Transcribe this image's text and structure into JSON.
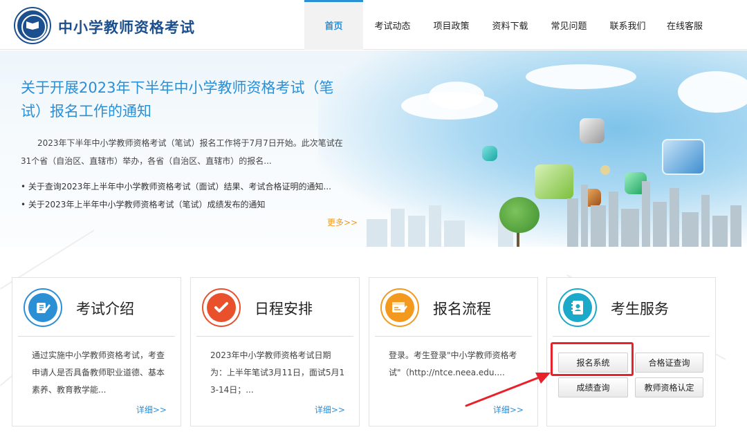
{
  "header": {
    "site_title": "中小学教师资格考试",
    "nav": [
      {
        "label": "首页",
        "active": true
      },
      {
        "label": "考试动态"
      },
      {
        "label": "项目政策"
      },
      {
        "label": "资料下载"
      },
      {
        "label": "常见问题"
      },
      {
        "label": "联系我们"
      },
      {
        "label": "在线客服"
      }
    ]
  },
  "banner": {
    "title": "关于开展2023年下半年中小学教师资格考试（笔试）报名工作的通知",
    "summary": "2023年下半年中小学教师资格考试（笔试）报名工作将于7月7日开始。此次笔试在31个省（自治区、直辖市）举办，各省（自治区、直辖市）的报名...",
    "news": [
      "关于查询2023年上半年中小学教师资格考试（面试）结果、考试合格证明的通知...",
      "关于2023年上半年中小学教师资格考试（笔试）成绩发布的通知"
    ],
    "more": "更多>>"
  },
  "cards": [
    {
      "title": "考试介绍",
      "text": "通过实施中小学教师资格考试，考查申请人是否具备教师职业道德、基本素养、教育教学能...",
      "more": "详细>>",
      "color": "#2b8fd6",
      "icon": "pencil-note-icon"
    },
    {
      "title": "日程安排",
      "text": "2023年中小学教师资格考试日期为：上半年笔试3月11日，面试5月13-14日；...",
      "more": "详细>>",
      "color": "#e8512b",
      "icon": "checkmark-icon"
    },
    {
      "title": "报名流程",
      "text": "登录。考生登录\"中小学教师资格考试\"（http://ntce.neea.edu....",
      "more": "详细>>",
      "color": "#f39a1e",
      "icon": "form-edit-icon"
    },
    {
      "title": "考生服务",
      "color": "#1aa9c9",
      "icon": "contact-book-icon"
    }
  ],
  "services": {
    "registration": "报名系统",
    "certificate_query": "合格证查询",
    "score_query": "成绩查询",
    "teacher_qualification": "教师资格认定"
  },
  "annotation": {
    "highlight_color": "#e8212b"
  }
}
